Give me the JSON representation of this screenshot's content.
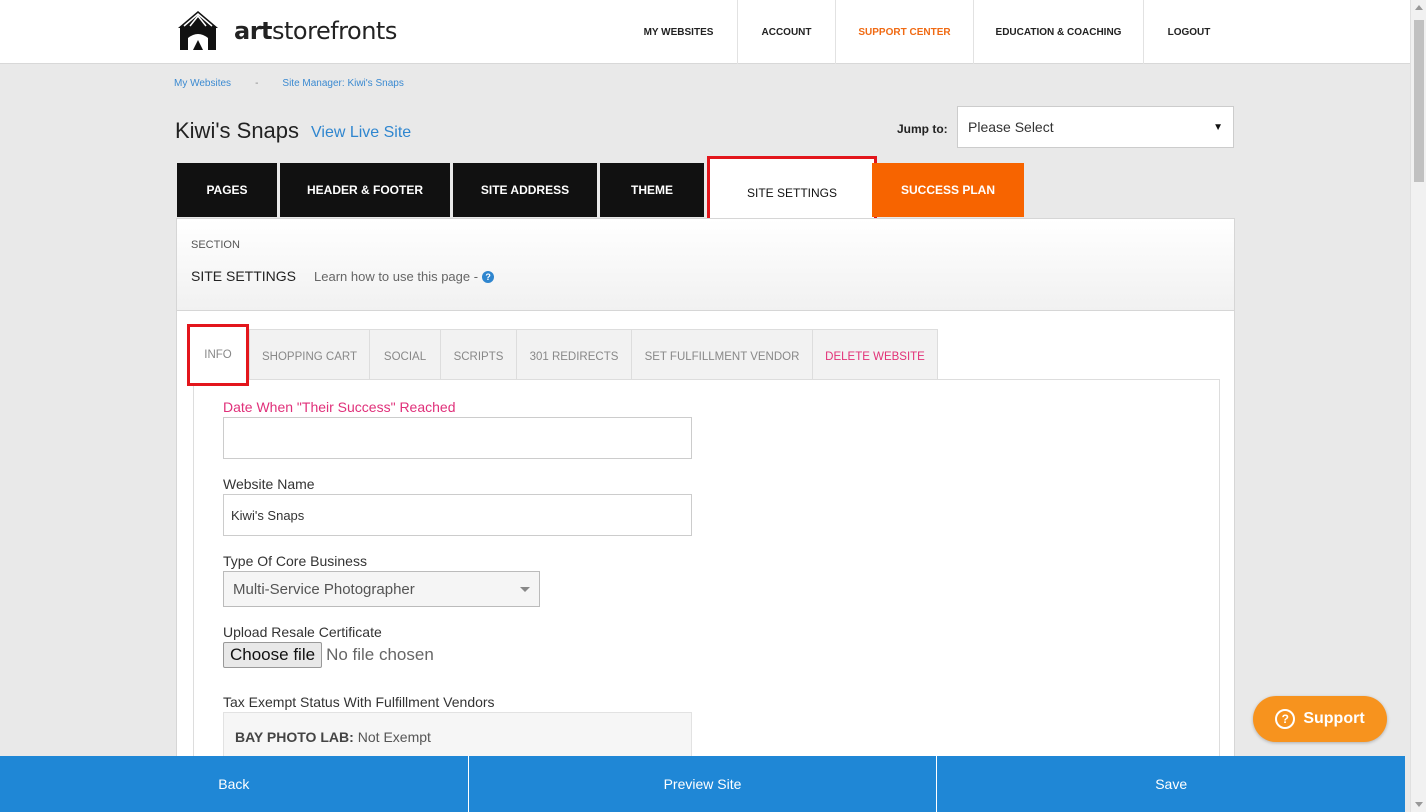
{
  "brand": {
    "logo_bold": "art",
    "logo_rest": "storefronts"
  },
  "nav": [
    {
      "label": "MY WEBSITES"
    },
    {
      "label": "ACCOUNT"
    },
    {
      "label": "SUPPORT CENTER"
    },
    {
      "label": "EDUCATION & COACHING"
    },
    {
      "label": "LOGOUT"
    }
  ],
  "breadcrumb": {
    "first": "My Websites",
    "separator": "-",
    "second": "Site Manager: Kiwi's Snaps"
  },
  "site": {
    "title": "Kiwi's Snaps",
    "view_live": "View Live Site"
  },
  "jump": {
    "label": "Jump to:",
    "value": "Please Select"
  },
  "tabs": [
    {
      "label": "PAGES"
    },
    {
      "label": "HEADER & FOOTER"
    },
    {
      "label": "SITE ADDRESS"
    },
    {
      "label": "THEME"
    },
    {
      "label": "SITE SETTINGS"
    },
    {
      "label": "SUCCESS PLAN"
    }
  ],
  "section": {
    "label": "SECTION",
    "title": "SITE SETTINGS",
    "learn": "Learn how to use this page -",
    "help_glyph": "?"
  },
  "subtabs": [
    {
      "label": "INFO"
    },
    {
      "label": "SHOPPING CART"
    },
    {
      "label": "SOCIAL"
    },
    {
      "label": "SCRIPTS"
    },
    {
      "label": "301 REDIRECTS"
    },
    {
      "label": "SET FULFILLMENT VENDOR"
    },
    {
      "label": "DELETE WEBSITE"
    }
  ],
  "form": {
    "success_date_label": "Date When \"Their Success\" Reached",
    "success_date_value": "",
    "website_name_label": "Website Name",
    "website_name_value": "Kiwi's Snaps",
    "core_business_label": "Type Of Core Business",
    "core_business_value": "Multi-Service Photographer",
    "resale_label": "Upload Resale Certificate",
    "file_button": "Choose file",
    "file_status": "No file chosen",
    "tax_label": "Tax Exempt Status With Fulfillment Vendors",
    "vendor_name": "BAY PHOTO LAB:",
    "vendor_status": "Not Exempt"
  },
  "actions": {
    "back": "Back",
    "preview": "Preview Site",
    "save": "Save"
  },
  "support": {
    "label": "Support",
    "glyph": "?"
  },
  "colors": {
    "accent_blue": "#1f87d6",
    "orange": "#f76400",
    "highlight_red": "#e3161c",
    "pink": "#e0307a"
  }
}
